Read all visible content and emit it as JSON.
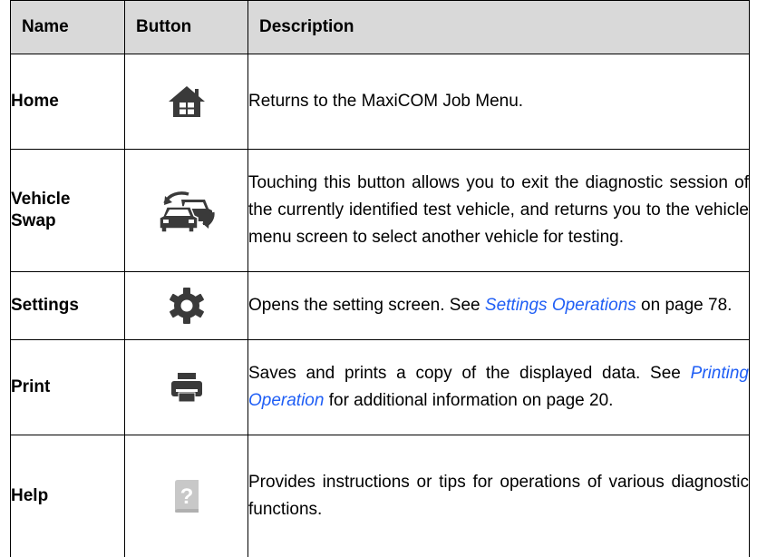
{
  "headers": {
    "name": "Name",
    "button": "Button",
    "description": "Description"
  },
  "rows": [
    {
      "name": "Home",
      "icon": "home-icon",
      "desc": "Returns to the MaxiCOM Job Menu."
    },
    {
      "name_line1": "Vehicle",
      "name_line2": "Swap",
      "icon": "vehicle-swap-icon",
      "desc": "Touching this button allows you to exit the diagnostic session of the currently identified test vehicle, and returns you to the vehicle menu screen to select another vehicle for testing."
    },
    {
      "name": "Settings",
      "icon": "gear-icon",
      "desc_before": "Opens the setting screen. See ",
      "desc_link": "Settings Operations",
      "desc_after": " on page 78."
    },
    {
      "name": "Print",
      "icon": "printer-icon",
      "desc_before": "Saves and prints a copy of the displayed data. See ",
      "desc_link": "Printing Operation",
      "desc_after": " for additional information on page 20."
    },
    {
      "name": "Help",
      "icon": "help-icon",
      "desc": "Provides instructions or tips for operations of various diagnostic functions."
    }
  ],
  "colors": {
    "header_bg": "#d9d9d9",
    "icon": "#3a3a3a",
    "help_icon": "#c8c8c8",
    "link": "#1f5ef5"
  }
}
